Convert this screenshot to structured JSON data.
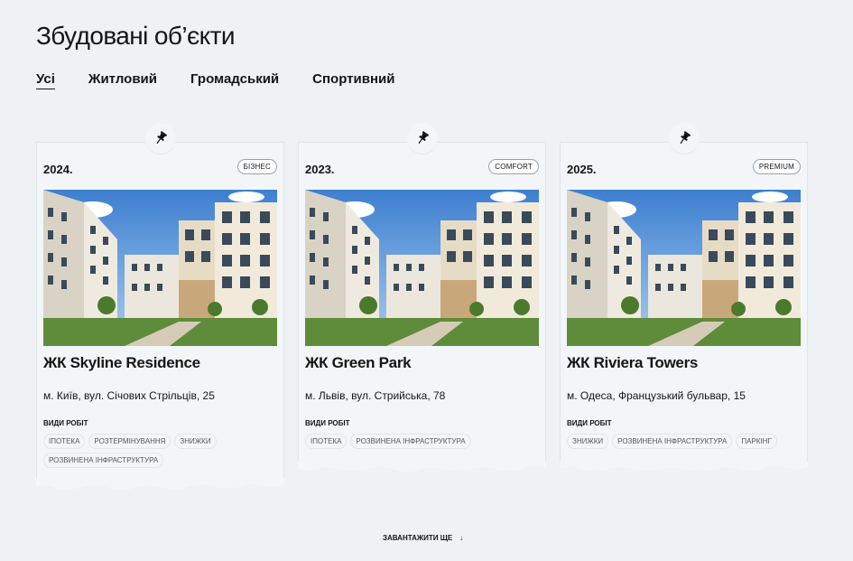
{
  "page": {
    "title": "Збудовані об’єкти"
  },
  "tabs": [
    {
      "label": "Усі",
      "active": true
    },
    {
      "label": "Житловий"
    },
    {
      "label": "Громадський"
    },
    {
      "label": "Спортивний"
    }
  ],
  "cards": [
    {
      "year": "2024.",
      "badge": "Бізнес",
      "name": "ЖК Skyline Residence",
      "address": "м. Київ, вул. Січових Стрільців, 25",
      "works_label": "Види робіт",
      "tags": [
        "Іпотека",
        "Розтермінування",
        "Знижки",
        "Розвинена інфраструктура"
      ]
    },
    {
      "year": "2023.",
      "badge": "Comfort",
      "name": "ЖК Green Park",
      "address": "м. Львів, вул. Стрийська, 78",
      "works_label": "Види робіт",
      "tags": [
        "Іпотека",
        "Розвинена інфраструктура"
      ]
    },
    {
      "year": "2025.",
      "badge": "Premium",
      "name": "ЖК Riviera Towers",
      "address": "м. Одеса, Французький бульвар, 15",
      "works_label": "Види робіт",
      "tags": [
        "Знижки",
        "Розвинена інфраструктура",
        "Паркінг"
      ]
    }
  ],
  "load_more": {
    "label": "Завантажити ще",
    "icon": "arrow-down-icon"
  },
  "colors": {
    "background": "#eef2f5",
    "text": "#151515",
    "card_bg": "#f3f6f8"
  }
}
